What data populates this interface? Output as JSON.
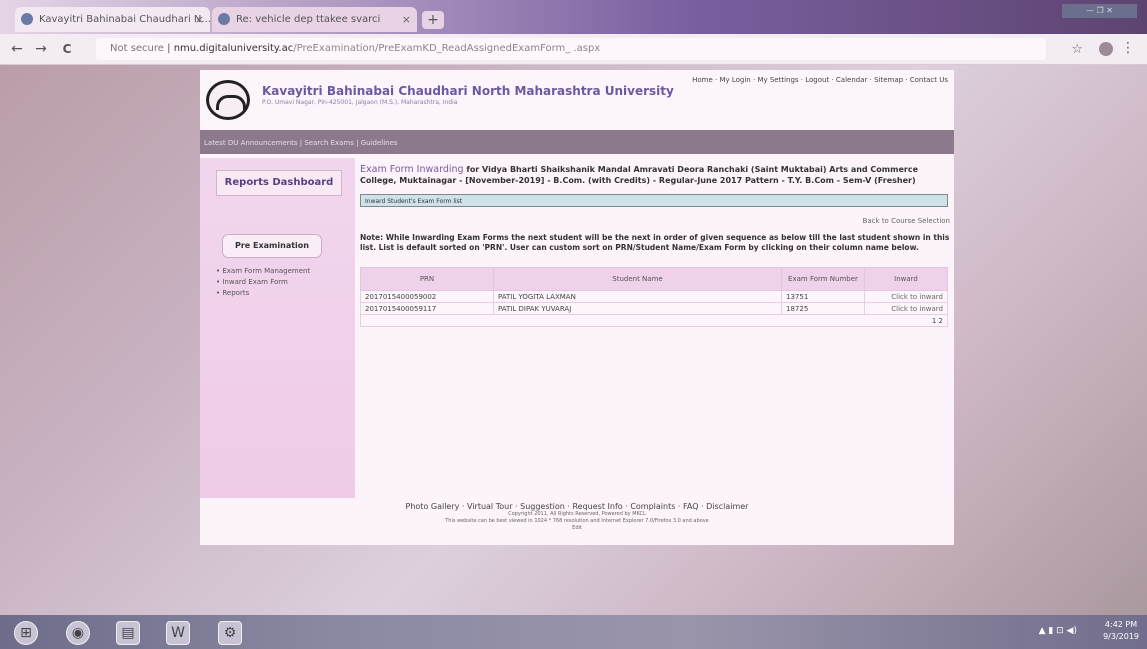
{
  "browser": {
    "tabs": [
      {
        "label": "Kavayitri Bahinabai Chaudhari N..."
      },
      {
        "label": "Re: vehicle dep ttakee svarci"
      }
    ],
    "nav": {
      "back": "←",
      "forward": "→",
      "reload": "C"
    },
    "address": {
      "security": "Not secure",
      "host": "nmu.digitaluniversity.ac",
      "path": "/PreExamination/PreExamKD_ReadAssignedExamForm_ .aspx"
    },
    "star": "☆",
    "menu": "⋮",
    "window_controls": "— ❐ ✕"
  },
  "header": {
    "university_name": "Kavayitri Bahinabai Chaudhari North Maharashtra University",
    "university_sub": "P.O. Umavi Nagar, Pin-425001, Jalgaon (M.S.), Maharashtra, India",
    "top_links": [
      "Home",
      "My Login",
      "My Settings",
      "Logout",
      "Calendar",
      "Sitemap",
      "Contact Us"
    ],
    "breadcrumb": "Latest DU Announcements | Search Exams | Guidelines"
  },
  "sidebar": {
    "reports_tab": "Reports Dashboard",
    "section": "Pre Examination",
    "links": [
      "Exam Form Management",
      "Inward Exam Form",
      "Reports"
    ]
  },
  "main": {
    "title_lead": "Exam Form Inwarding",
    "title_rest": " for Vidya Bharti Shaikshanik Mandal Amravati Deora Ranchaki (Saint Muktabai) Arts and Commerce College, Muktainagar - [November-2019] - B.Com. (with Credits) - Regular-June 2017 Pattern - T.Y. B.Com - Sem-V (Fresher)",
    "filter_label": "Inward Student's Exam Form list",
    "back_link": "Back to Course Selection",
    "note": "Note: While Inwarding Exam Forms the next student will be the next in order of given sequence as below till the last student shown in this list. List is default sorted on 'PRN'. User can custom sort on PRN/Student Name/Exam Form by clicking on their column name below.",
    "table": {
      "headers": [
        "PRN",
        "Student Name",
        "Exam Form Number",
        "Inward"
      ],
      "rows": [
        [
          "2017015400059002",
          "PATIL YOGITA LAXMAN",
          "13751",
          "Click to inward"
        ],
        [
          "2017015400059117",
          "PATIL DIPAK YUVARAJ",
          "18725",
          "Click to inward"
        ]
      ],
      "pager": "1 2"
    }
  },
  "footer": {
    "links": [
      "Photo Gallery",
      "Virtual Tour",
      "Suggestion",
      "Request Info",
      "Complaints",
      "FAQ",
      "Disclaimer"
    ],
    "copyright": "Copyright 2011, All Rights Reserved, Powered by MKCL",
    "compat": "This website can be best viewed in 1024 * 768 resolution and Internet Explorer 7.0/Firefox 3.0 and above",
    "extra": "Edit"
  },
  "taskbar": {
    "icons": [
      "start",
      "chrome",
      "file-explorer",
      "word",
      "settings"
    ],
    "clock_time": "4:42 PM",
    "clock_date": "9/3/2019"
  }
}
